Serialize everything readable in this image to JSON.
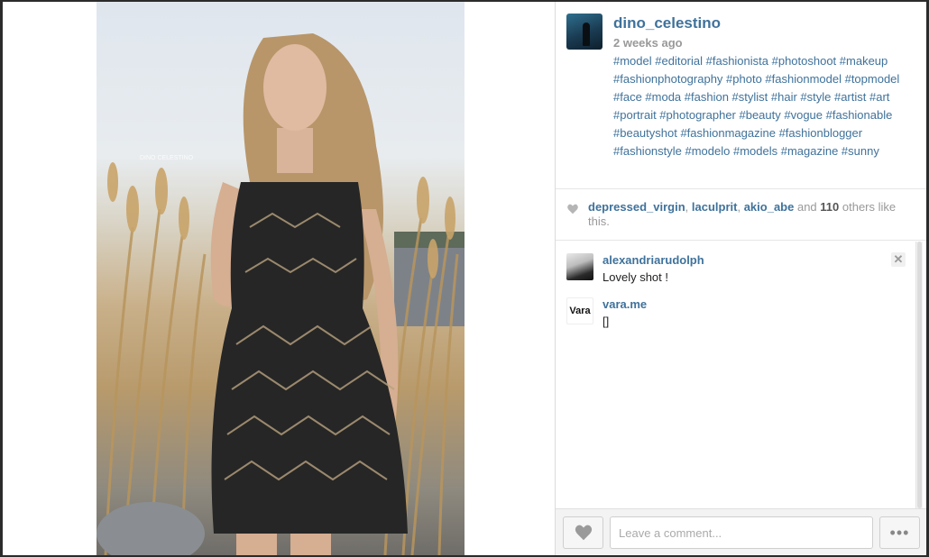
{
  "post": {
    "username": "dino_celestino",
    "time_ago": "2 weeks ago",
    "caption": "#model #editorial #fashionista #photoshoot #makeup #fashionphotography #photo #fashionmodel #topmodel #face #moda #fashion #stylist #hair #style #artist #art #portrait #photographer #beauty #vogue #fashionable #beautyshot #fashionmagazine #fashionblogger #fashionstyle #modelo #models #magazine #sunny",
    "photo_watermark": "DINO CELESTINO"
  },
  "likes": {
    "user1": "depressed_virgin",
    "sep1": ", ",
    "user2": "laculprit",
    "sep2": ", ",
    "user3": "akio_abe",
    "and_text": " and ",
    "count": "110",
    "others_text": " others like this."
  },
  "comments": [
    {
      "username": "alexandriarudolph",
      "text": "Lovely shot !"
    },
    {
      "username": "vara.me",
      "text": "[]",
      "avatar_text": "Vara"
    }
  ],
  "footer": {
    "comment_placeholder": "Leave a comment...",
    "more_label": "•••"
  },
  "colors": {
    "link": "#3f729b",
    "muted": "#999999"
  },
  "icons": {
    "like": "heart-icon",
    "close": "close-icon",
    "more": "more-options-icon"
  }
}
